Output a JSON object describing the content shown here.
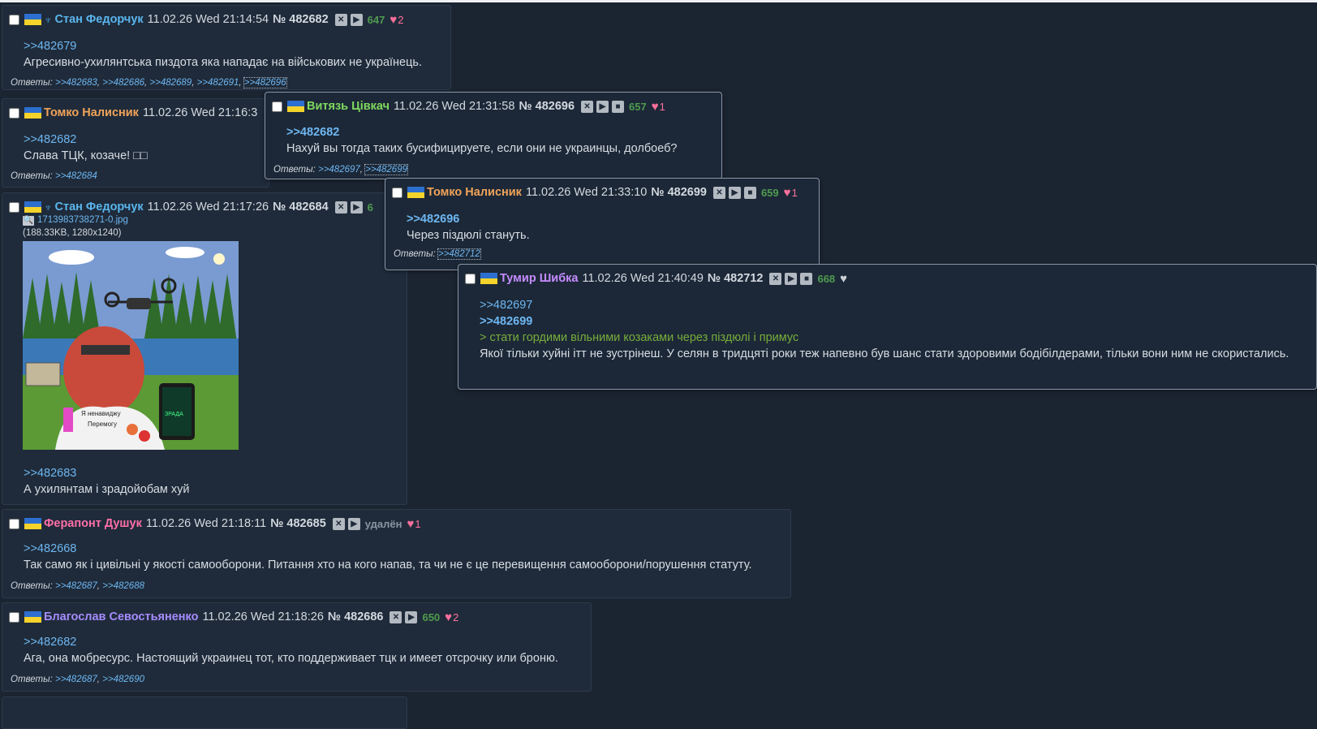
{
  "posts": [
    {
      "flag_icon": "ukraine-flag-icon",
      "name": "Стан Федорчук",
      "name_color": "#5ab6ee",
      "date": "11.02.26 Wed 21:14:54",
      "num": "№ 482682",
      "count": "647",
      "likes": "2",
      "quotes": [
        ">>482679"
      ],
      "text": "Агресивно-ухилянтська пиздота яка нападає на військових не українець.",
      "replies_label": "Ответы:",
      "replies": [
        ">>482683",
        ">>482686",
        ">>482689",
        ">>482691",
        ">>482696"
      ]
    },
    {
      "name": "Томко Налисник",
      "name_color": "#f0a35a",
      "date": "11.02.26 Wed 21:16:3",
      "quotes": [
        ">>482682"
      ],
      "text": "Слава ТЦК, козаче! □□",
      "replies_label": "Ответы:",
      "replies": [
        ">>482684"
      ]
    },
    {
      "name": "Стан Федорчук",
      "name_color": "#5ab6ee",
      "date": "11.02.26 Wed 21:17:26",
      "num": "№ 482684",
      "count_partial": "6",
      "file_name": "1713983738271-0.jpg",
      "file_meta": "(188.33KB, 1280x1240)",
      "quotes": [
        ">>482683"
      ],
      "text": "А ухилянтам і зрадойобам хуй",
      "image_lettering": [
        "Я ненавиджу Перемогу",
        "ЗРАДА"
      ]
    },
    {
      "name": "Ферапонт Душук",
      "name_color": "#ff6fa8",
      "date": "11.02.26 Wed 21:18:11",
      "num": "№ 482685",
      "deleted": "удалён",
      "likes": "1",
      "quotes": [
        ">>482668"
      ],
      "text": "Так само як і цивільні у якості самооборони. Питання хто на кого напав, та чи не є це перевищення самооборони/порушення статуту.",
      "replies_label": "Ответы:",
      "replies": [
        ">>482687",
        ">>482688"
      ]
    },
    {
      "name": "Благослав Севостьяненко",
      "name_color": "#a68cff",
      "date": "11.02.26 Wed 21:18:26",
      "num": "№ 482686",
      "count": "650",
      "likes": "2",
      "quotes": [
        ">>482682"
      ],
      "text": "Ага, она мобресурс. Настоящий украинец тот, кто поддерживает тцк и имеет отсрочку или броню.",
      "replies_label": "Ответы:",
      "replies": [
        ">>482687",
        ">>482690"
      ]
    }
  ],
  "popups": [
    {
      "name": "Витязь Цівкач",
      "name_color": "#7fd95e",
      "date": "11.02.26 Wed 21:31:58",
      "num": "№ 482696",
      "count": "657",
      "likes": "1",
      "quotes": [
        ">>482682"
      ],
      "text": "Нахуй вы тогда таких бусифицируете, если они не украинцы, долбоеб?",
      "replies_label": "Ответы:",
      "replies": [
        ">>482697",
        ">>482699"
      ]
    },
    {
      "name": "Томко Налисник",
      "name_color": "#f0a35a",
      "date": "11.02.26 Wed 21:33:10",
      "num": "№ 482699",
      "count": "659",
      "likes": "1",
      "quotes": [
        ">>482696"
      ],
      "text": "Через піздюлі стануть.",
      "replies_label": "Ответы:",
      "replies": [
        ">>482712"
      ]
    },
    {
      "name": "Тумир Шибка",
      "name_color": "#c58cff",
      "date": "11.02.26 Wed 21:40:49",
      "num": "№ 482712",
      "count": "668",
      "quotes": [
        ">>482697",
        ">>482699"
      ],
      "greentext": "> стати гордими вільними козаками через піздюлі і примус",
      "text": "Якої тільки хуйні ітт не зустрінеш. У селян в тридцяті роки теж напевно був шанс стати здоровими бодібілдерами, тільки вони ним не скористались."
    }
  ],
  "icons": {
    "hide": "close-x-icon",
    "play": "play-icon",
    "stop": "stop-icon",
    "like": "heart-icon",
    "search": "magnifier-icon"
  }
}
